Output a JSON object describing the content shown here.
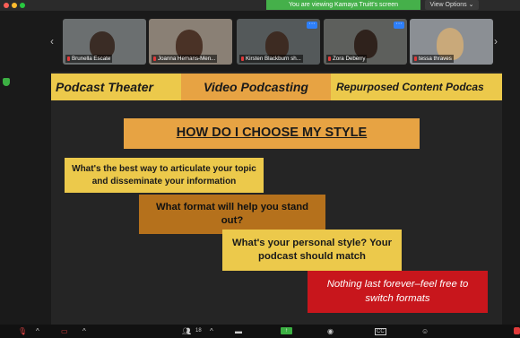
{
  "share_banner": "You are viewing Kamaya Truitt's screen",
  "view_options": "View Options ⌄",
  "participants": [
    {
      "name": "Brunella Escate",
      "bg": "#6b6f70"
    },
    {
      "name": "Joanna Hemans-Men...",
      "bg": "#8a8075"
    },
    {
      "name": "Kirsten Blackburn sh...",
      "bg": "#54595a"
    },
    {
      "name": "Zora Deberry",
      "bg": "#5d5f5c"
    },
    {
      "name": "tessa thraves",
      "bg": "#8b8f94"
    }
  ],
  "slide": {
    "headers": [
      "Podcast Theater",
      "Video Podcasting",
      "Repurposed Content Podcas"
    ],
    "title": "HOW DO I CHOOSE MY STYLE",
    "q1": "What's the best way to articulate your topic and disseminate your information",
    "q2": "What format will help you stand out?",
    "q3": "What's your personal style? Your podcast should match",
    "q4": "Nothing last forever–feel free to switch formats"
  },
  "toolbar": {
    "participants_count": "18"
  },
  "colors": {
    "gold": "#ecc94b",
    "orange": "#e7a343",
    "brown": "#b5711c",
    "red": "#c8161c"
  }
}
